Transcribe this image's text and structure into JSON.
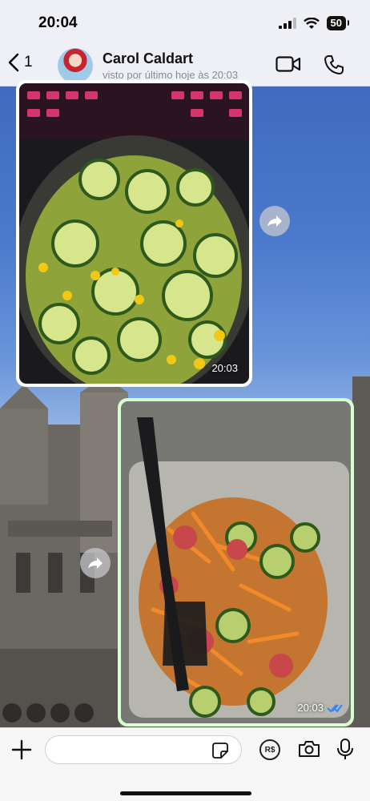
{
  "status_bar": {
    "time": "20:04",
    "battery": "50"
  },
  "header": {
    "back_count": "1",
    "contact_name": "Carol Caldart",
    "last_seen": "visto por último hoje às 20:03"
  },
  "messages": [
    {
      "direction": "incoming",
      "type": "photo",
      "time": "20:03",
      "description_icon": "cucumber-corn-salad-photo"
    },
    {
      "direction": "outgoing",
      "type": "photo",
      "time": "20:03",
      "status": "read",
      "description_icon": "carrot-salad-photo"
    }
  ],
  "input_bar": {
    "placeholder": "",
    "pay_label": "R$"
  },
  "colors": {
    "outgoing_bubble": "#d9fdd3",
    "read_ticks": "#3b82f6",
    "incoming_bubble": "#ffffff"
  }
}
